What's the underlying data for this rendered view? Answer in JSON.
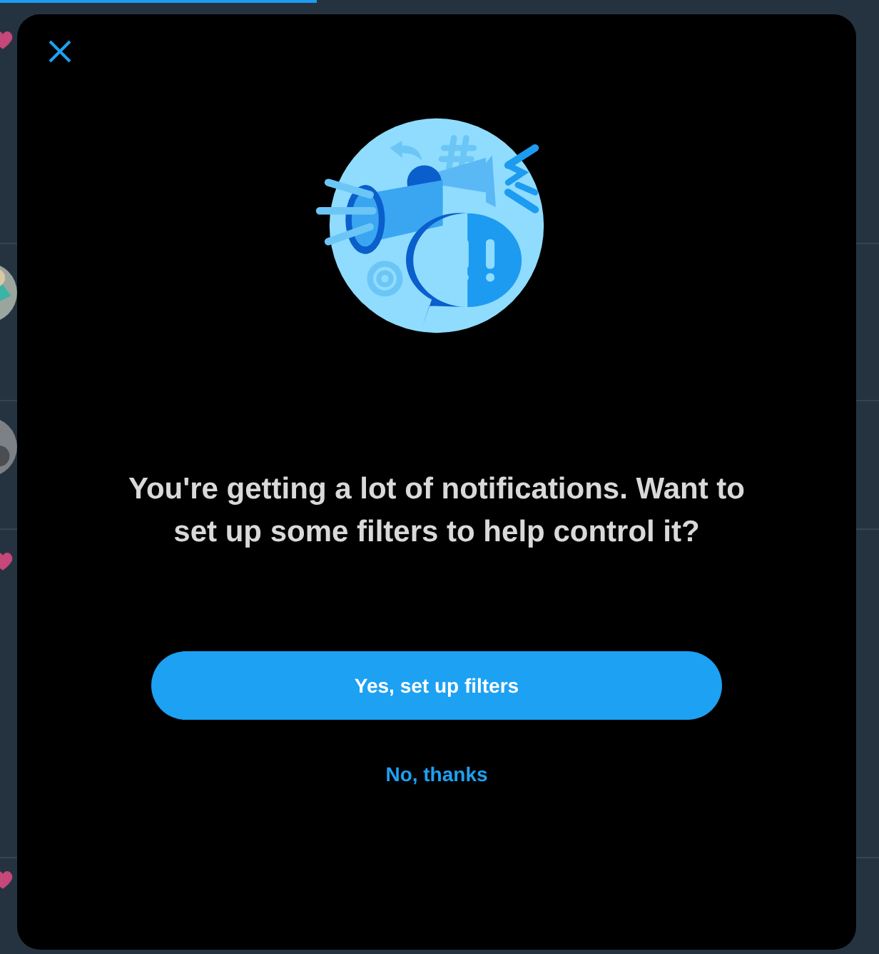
{
  "dialog": {
    "message": "You're getting a lot of notifications. Want to set up some filters to help control it?",
    "primary_button": "Yes, set up filters",
    "secondary_button": "No, thanks"
  }
}
